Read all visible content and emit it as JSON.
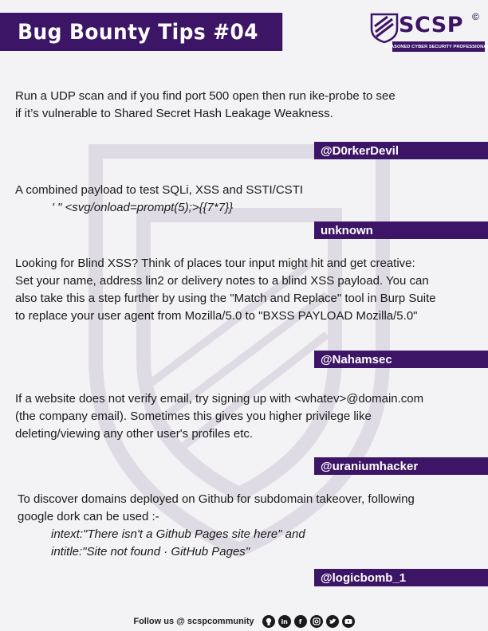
{
  "header": {
    "title": "Bug Bounty Tips #04",
    "logo_text": "SCSP",
    "logo_symbol": "©",
    "logo_tagline": "SEASONED CYBER SECURITY PROFESSIONALS"
  },
  "colors": {
    "accent": "#3d1566",
    "background": "#f3f3f5",
    "text": "#1a1a1a"
  },
  "tips": [
    {
      "lines": [
        "Run a UDP scan and if you find port 500 open then run ike-probe to see",
        "if it’s vulnerable to Shared Secret Hash Leakage Weakness."
      ],
      "author": "@D0rkerDevil"
    },
    {
      "lines": [
        "A combined payload to test SQLi, XSS and SSTI/CSTI"
      ],
      "payload": "' \" <svg/onload=prompt(5);>{{7*7}}",
      "author": "unknown"
    },
    {
      "lines": [
        "Looking for Blind XSS? Think of places tour input might hit and get creative:",
        "Set your name, address lin2 or delivery notes to a blind XSS payload. You can",
        "also take this a step further by using the \"Match and Replace\" tool in Burp Suite",
        "to replace your user agent from Mozilla/5.0 to \"BXSS PAYLOAD Mozilla/5.0\""
      ],
      "author": "@Nahamsec"
    },
    {
      "lines": [
        "If a website does not verify email, try signing up with <whatev>@domain.com",
        "(the company email). Sometimes this gives you higher privilege like",
        "deleting/viewing any other user's profiles etc."
      ],
      "author": "@uraniumhacker"
    },
    {
      "lines": [
        "To discover domains deployed on Github for subdomain takeover, following",
        "google dork can be used :-"
      ],
      "dorks": [
        "intext:\"There isn't a Github Pages site here\" and",
        "intitle:\"Site not found · GitHub Pages\""
      ],
      "author": "@logicbomb_1"
    }
  ],
  "footer": {
    "text": "Follow us @ scspcommunity",
    "icons": [
      "github-icon",
      "linkedin-icon",
      "facebook-icon",
      "instagram-icon",
      "twitter-icon",
      "youtube-icon"
    ]
  }
}
